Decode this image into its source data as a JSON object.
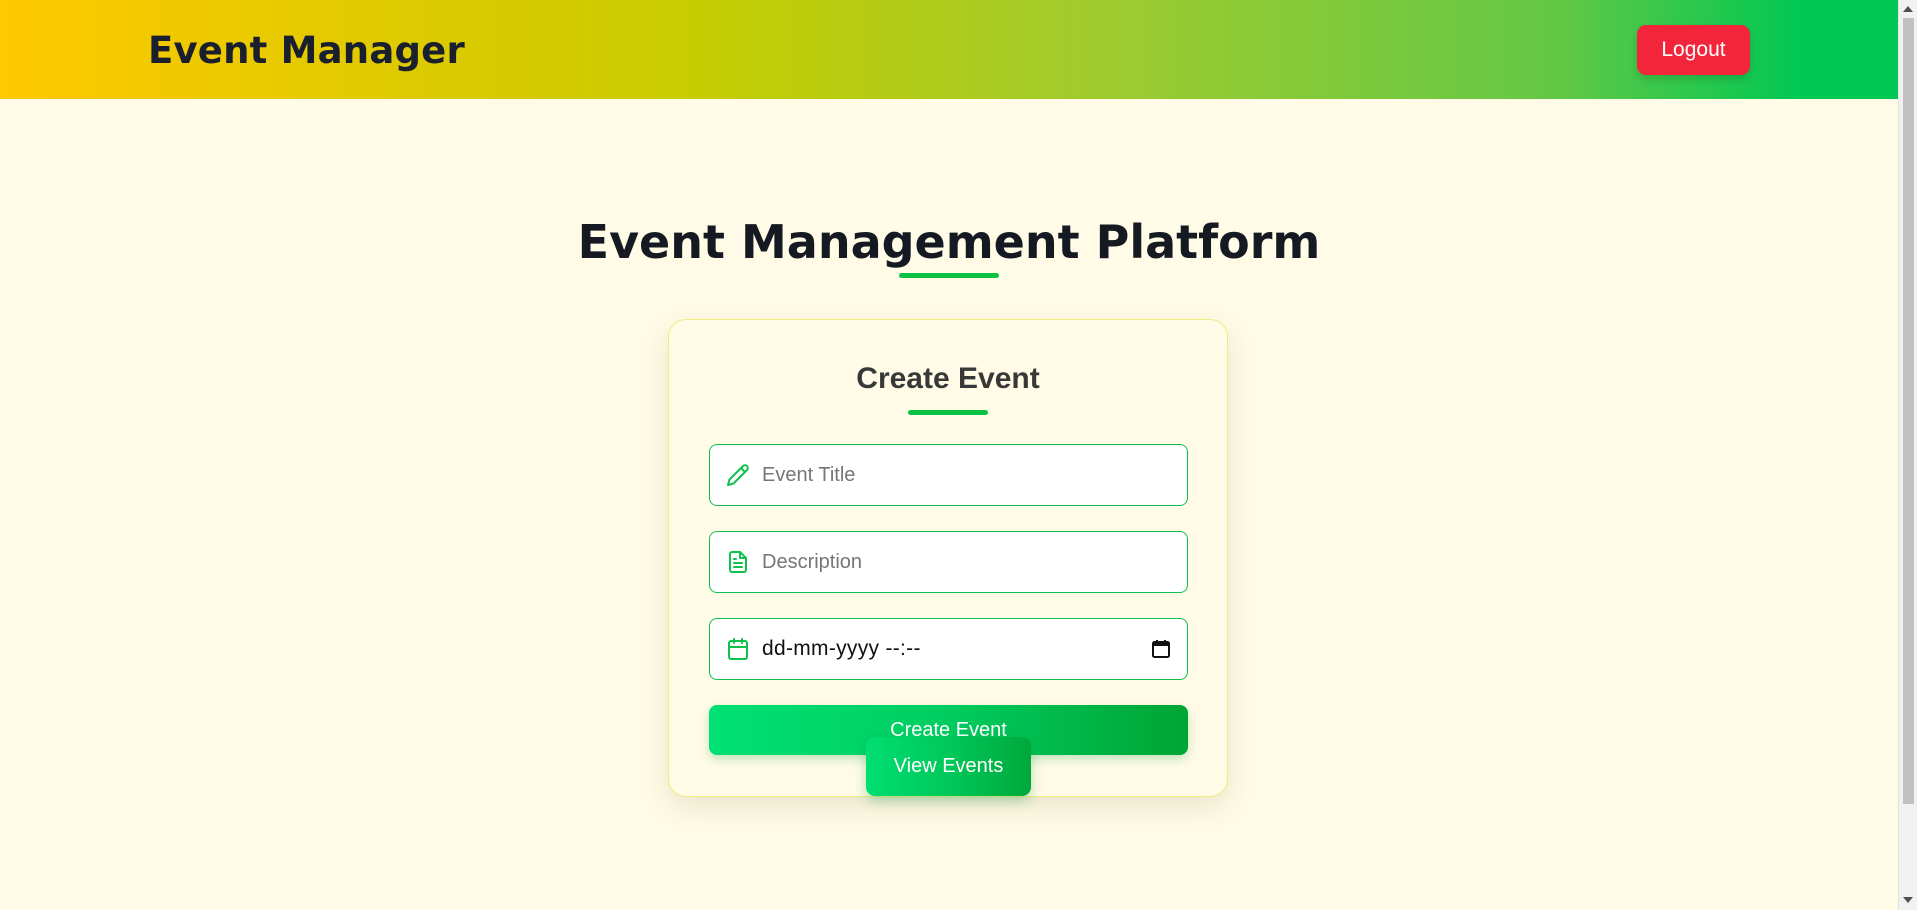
{
  "navbar": {
    "brand": "Event Manager",
    "logout_label": "Logout"
  },
  "main": {
    "page_title": "Event Management Platform"
  },
  "create_form": {
    "title": "Create Event",
    "title_input": {
      "placeholder": "Event Title",
      "value": "",
      "icon": "pencil-icon"
    },
    "description_input": {
      "placeholder": "Description",
      "value": "",
      "icon": "document-icon"
    },
    "datetime_input": {
      "display": "dd-mm-yyyy --:--",
      "icon": "calendar-icon"
    },
    "submit_label": "Create Event"
  },
  "view_events_label": "View Events",
  "colors": {
    "accent_green": "#08c246",
    "logout_red": "#f3253a",
    "background": "#fffbe7"
  }
}
